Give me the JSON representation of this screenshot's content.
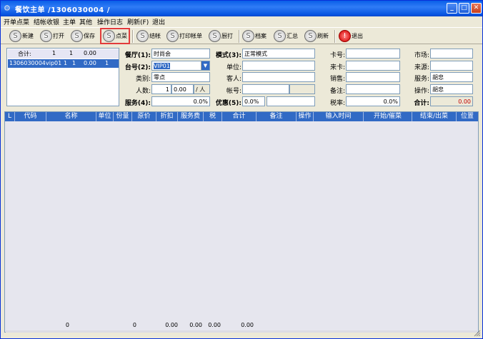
{
  "window": {
    "title": "餐饮主单 /1306030004 /",
    "icon": "app-icon"
  },
  "menu": [
    "开单点菜",
    "结帐收银",
    "主单",
    "其他",
    "操作日志",
    "刷新(F)",
    "退出"
  ],
  "toolbar": {
    "new": "新建",
    "open": "打开",
    "save": "保存",
    "order": "点菜",
    "checkout": "结帐",
    "print_bill": "打印帐单",
    "print": "厨打",
    "archive": "档案",
    "summary": "汇总",
    "refresh": "刷新",
    "exit": "退出"
  },
  "left_list": {
    "header": {
      "label": "合计:",
      "c1": "1",
      "c2": "1",
      "c3": "0.00"
    },
    "rows": [
      {
        "id": "1306030004",
        "table": "vip01",
        "c1": "1",
        "c2": "1",
        "amount": "0.00",
        "c4": "1"
      }
    ]
  },
  "form": {
    "restaurant_label": "餐厅(1):",
    "restaurant_value": "时尚会",
    "table_label": "台号(2):",
    "table_value": "VIP01",
    "category_label": "类别:",
    "category_value": "零点",
    "people_label": "人数:",
    "people_value": "1",
    "people_extra": "0.00",
    "people_unit": "/ 人",
    "service_label": "服务(4):",
    "service_value": "0.0%",
    "mode_label": "模式(3):",
    "mode_value": "正常模式",
    "unit_label": "单位:",
    "unit_value": "",
    "guest_label": "客人:",
    "guest_value": "",
    "account_label": "帐号:",
    "account_value": "",
    "discount_label": "优惠(5):",
    "discount_value": "0.0%",
    "card_label": "卡号:",
    "card_value": "",
    "source_card_label": "来卡:",
    "source_card_value": "",
    "sales_label": "销售:",
    "sales_value": "",
    "remark_label": "备注:",
    "remark_value": "",
    "tax_label": "税率:",
    "tax_value": "0.0%",
    "market_label": "市场:",
    "market_value": "",
    "source_label": "来源:",
    "source_value": "",
    "server_label": "服务:",
    "server_value": "胡忠",
    "operator_label": "操作:",
    "operator_value": "胡忠",
    "total_label": "合计:",
    "total_value": "0.00"
  },
  "grid": {
    "columns": [
      "L",
      "代码",
      "名称",
      "单位",
      "份量",
      "原价",
      "折扣",
      "服务费",
      "税",
      "合计",
      "备注",
      "操作",
      "输入时间",
      "开始/催菜",
      "结束/出菜",
      "位置"
    ],
    "footer": {
      "qty": "0",
      "price": "0",
      "discount": "0.00",
      "service": "0.00",
      "tax": "0.00",
      "total": "0.00"
    }
  }
}
